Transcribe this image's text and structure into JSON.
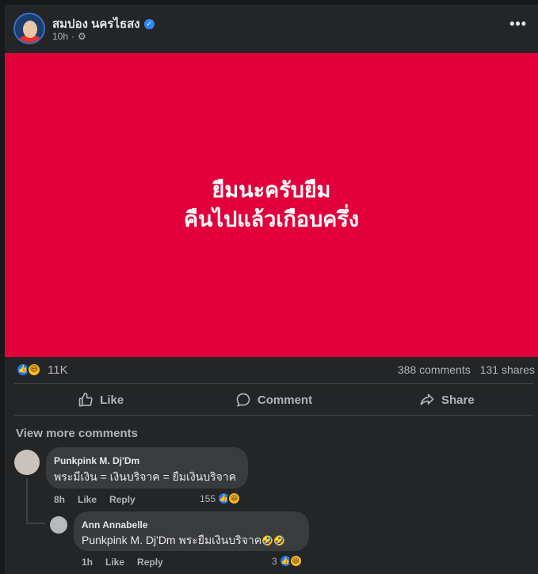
{
  "post": {
    "author": "สมปอง นครไธสง",
    "time": "10h",
    "separator": "·",
    "banner_lines": [
      "ยืมนะครับยืม",
      "คืนไปแล้วเกือบครึ่ง"
    ],
    "banner_color": "#e2003b",
    "reaction_count": "11K",
    "comments_count": "388 comments",
    "shares_count": "131 shares"
  },
  "actions": {
    "like": "Like",
    "comment": "Comment",
    "share": "Share"
  },
  "view_more": "View more comments",
  "comments": [
    {
      "name": "Punkpink M. Dj'Dm",
      "text": "พระมีเงิน = เงินบริจาค = ยืมเงินบริจาค",
      "time": "8h",
      "like_label": "Like",
      "reply_label": "Reply",
      "reaction_count": "155"
    },
    {
      "name": "Ann Annabelle",
      "text": "Punkpink M. Dj'Dm พระยืมเงินบริจาค",
      "emojis": "🤣🤣",
      "time": "1h",
      "like_label": "Like",
      "reply_label": "Reply",
      "reaction_count": "3"
    }
  ],
  "icons": {
    "verified": "verified-badge-icon",
    "privacy": "gear-icon",
    "more": "more-options-icon",
    "like": "thumbs-up-icon",
    "comment": "speech-bubble-icon",
    "share": "share-arrow-icon",
    "reaction_like": "like-reaction-icon",
    "reaction_haha": "haha-reaction-icon"
  }
}
